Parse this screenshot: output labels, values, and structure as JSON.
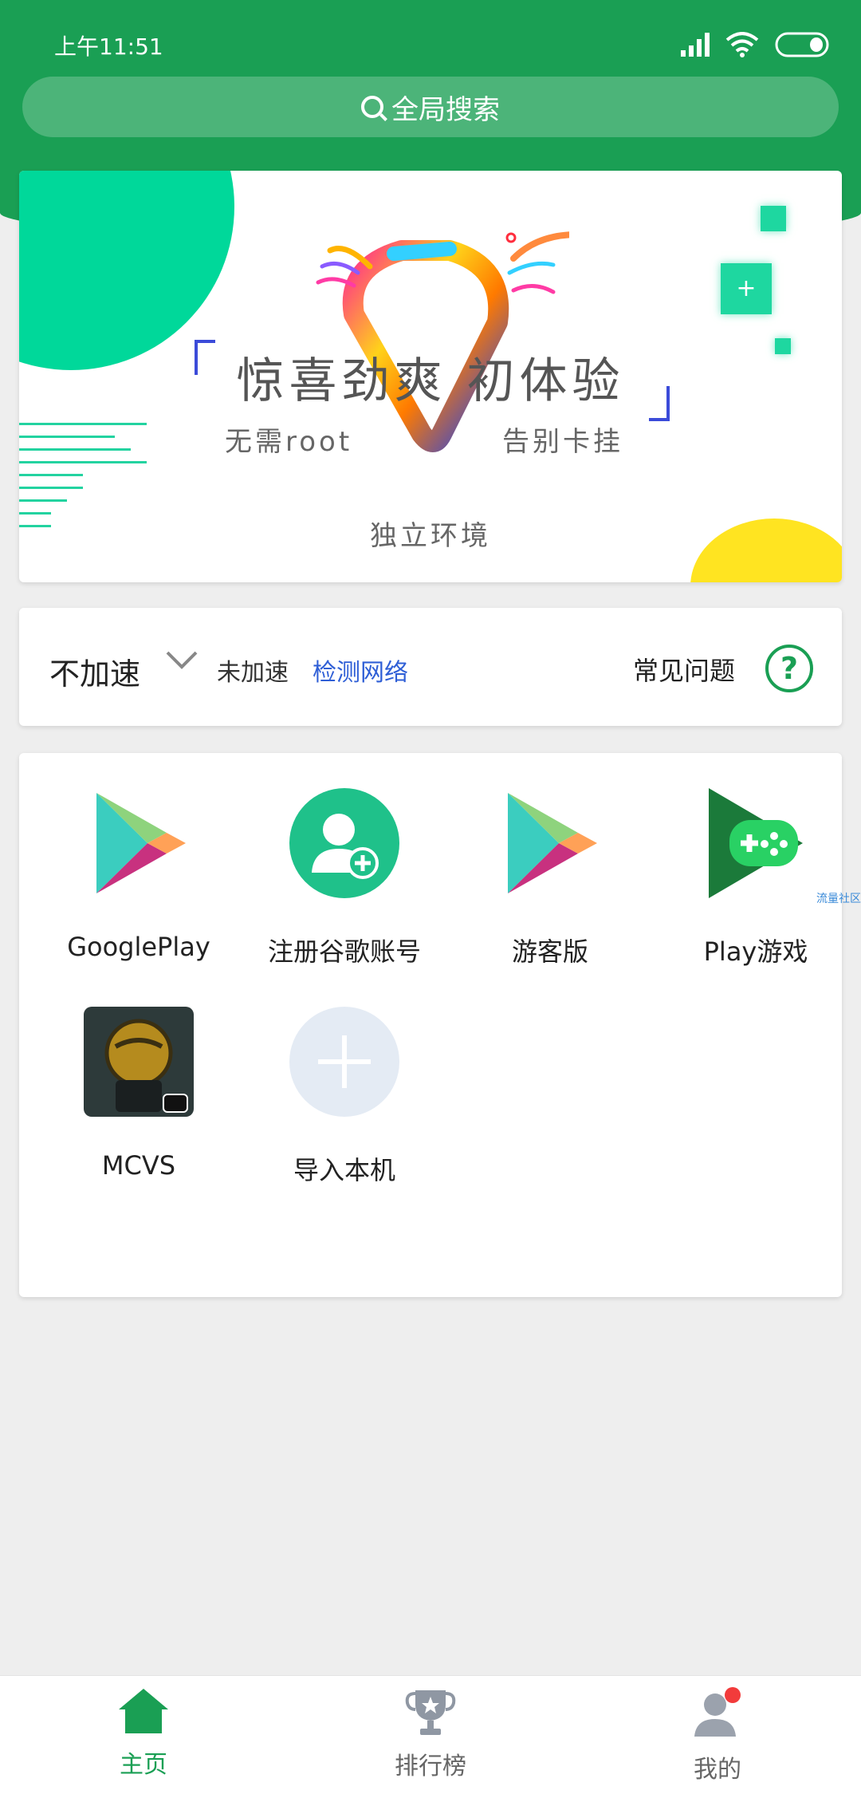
{
  "status_bar": {
    "time": "上午11:51"
  },
  "search": {
    "placeholder": "全局搜索"
  },
  "banner": {
    "headline": "惊喜劲爽  初体验",
    "sub_left": "无需root",
    "sub_right": "告别卡挂",
    "sub_bottom": "独立环境"
  },
  "speed_bar": {
    "mode_label": "不加速",
    "status_label": "未加速",
    "detect_label": "检测网络",
    "faq_label": "常见问题",
    "help_icon": "?"
  },
  "apps": [
    {
      "label": "GooglePlay",
      "icon": "google-play-icon"
    },
    {
      "label": "注册谷歌账号",
      "icon": "add-account-icon"
    },
    {
      "label": "游客版",
      "icon": "google-play-icon"
    },
    {
      "label": "Play游戏",
      "icon": "play-games-icon"
    },
    {
      "label": "MCVS",
      "icon": "mcvs-game-icon"
    },
    {
      "label": "导入本机",
      "icon": "add-icon"
    }
  ],
  "side_tag": "流量社区",
  "bottom_nav": [
    {
      "label": "主页",
      "icon": "home-icon",
      "active": true
    },
    {
      "label": "排行榜",
      "icon": "trophy-icon",
      "active": false
    },
    {
      "label": "我的",
      "icon": "user-icon",
      "active": false
    }
  ],
  "colors": {
    "brand": "#1a9f54",
    "accent": "#00d89a",
    "link": "#2f5fd6",
    "nav_inactive": "#777777"
  }
}
